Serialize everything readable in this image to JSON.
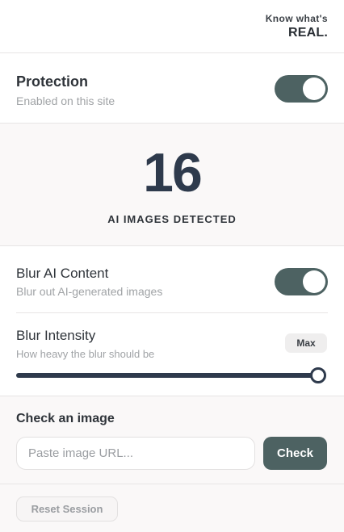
{
  "brand": {
    "tagline": "Know what's",
    "name": "REAL."
  },
  "protection": {
    "title": "Protection",
    "subtitle": "Enabled on this site",
    "enabled": true
  },
  "stats": {
    "count": "16",
    "label": "AI IMAGES DETECTED"
  },
  "blur": {
    "title": "Blur AI Content",
    "subtitle": "Blur out AI-generated images",
    "enabled": true,
    "intensity": {
      "title": "Blur Intensity",
      "subtitle": "How heavy the blur should be",
      "badge": "Max",
      "value": 1.0
    }
  },
  "check": {
    "title": "Check an image",
    "placeholder": "Paste image URL...",
    "button": "Check"
  },
  "footer": {
    "reset": "Reset Session"
  },
  "colors": {
    "accent": "#4d6262",
    "dark": "#2e3a4c",
    "muted": "#a0a3a6"
  }
}
